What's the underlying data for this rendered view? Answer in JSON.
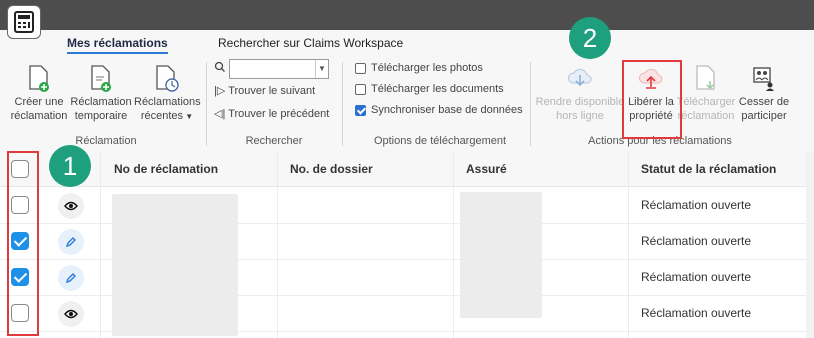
{
  "tabs": {
    "my_claims": "Mes réclamations",
    "search_workspace": "Rechercher sur Claims Workspace"
  },
  "ribbon": {
    "create_claim": [
      "Créer une",
      "réclamation"
    ],
    "temp_claim": [
      "Réclamation",
      "temporaire"
    ],
    "recent_claims": [
      "Réclamations",
      "récentes"
    ],
    "group_claim": "Réclamation",
    "find_next": "Trouver le suivant",
    "find_prev": "Trouver le précédent",
    "group_search": "Rechercher",
    "download_photos": "Télécharger les photos",
    "download_documents": "Télécharger les documents",
    "sync_db": "Synchroniser base de données",
    "group_download": "Options de téléchargement",
    "make_offline": [
      "Rendre disponible",
      "hors ligne"
    ],
    "release_property": [
      "Libérer la",
      "propriété"
    ],
    "download_claim": [
      "Télécharger",
      "réclamation"
    ],
    "stop_participating": [
      "Cesser de",
      "participer"
    ],
    "group_claims": "Actions pour les réclamations"
  },
  "checkboxes": {
    "photos_checked": false,
    "documents_checked": false,
    "sync_checked": true
  },
  "grid": {
    "headers": {
      "claim_no": "No de réclamation",
      "file_no": "No. de dossier",
      "insured": "Assuré",
      "status": "Statut de la réclamation"
    },
    "rows": [
      {
        "checked": false,
        "icon": "eye-icon",
        "status": "Réclamation ouverte"
      },
      {
        "checked": true,
        "icon": "pencil-icon",
        "status": "Réclamation ouverte"
      },
      {
        "checked": true,
        "icon": "pencil-icon",
        "status": "Réclamation ouverte"
      },
      {
        "checked": false,
        "icon": "eye-icon",
        "status": "Réclamation ouverte"
      }
    ]
  },
  "callouts": {
    "one": "1",
    "two": "2"
  },
  "colors": {
    "highlight": "#e0393e",
    "badge": "#1e9f7e",
    "accent": "#2b7bd5",
    "checked": "#1e90e8",
    "release_icon": "#e0393e"
  }
}
